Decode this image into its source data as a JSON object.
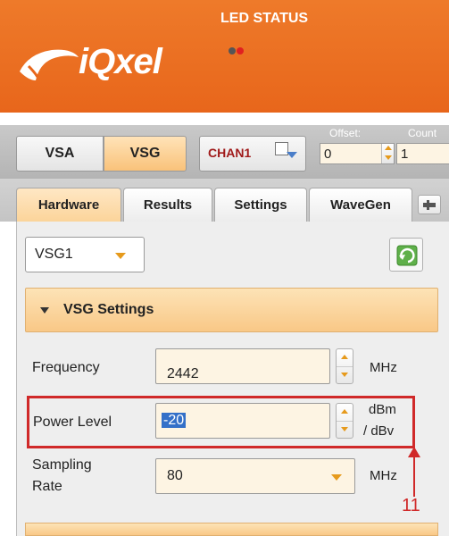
{
  "header": {
    "brand": "iQxel",
    "led_status_title": "LED STATUS",
    "leds": [
      {
        "state": "off",
        "color": "#555555"
      },
      {
        "state": "on",
        "color": "#e02020"
      }
    ],
    "background": "#e8661b"
  },
  "modes": {
    "vsa_label": "VSA",
    "vsg_label": "VSG",
    "active": "VSG",
    "channel_label": "CHAN1",
    "offset_label": "Offset:",
    "offset_value": "0",
    "count_label": "Count",
    "count_value": "1"
  },
  "tabs": [
    {
      "label": "Hardware",
      "active": true
    },
    {
      "label": "Results",
      "active": false
    },
    {
      "label": "Settings",
      "active": false
    },
    {
      "label": "WaveGen",
      "active": false
    }
  ],
  "device_select": {
    "value": "VSG1"
  },
  "section": {
    "title": "VSG Settings",
    "expanded": true
  },
  "fields": {
    "frequency": {
      "label": "Frequency",
      "value": "2442",
      "unit": "MHz"
    },
    "power_level": {
      "label": "Power Level",
      "value": "-20",
      "unit_line1": "dBm",
      "unit_line2": "/ dBv"
    },
    "sampling_rate": {
      "label_line1": "Sampling",
      "label_line2": "Rate",
      "value": "80",
      "unit": "MHz"
    }
  },
  "annotation": {
    "number": "11",
    "color": "#d02929"
  },
  "colors": {
    "accent": "#f9c27a",
    "orange": "#e8661b",
    "highlight": "#3470c8"
  }
}
